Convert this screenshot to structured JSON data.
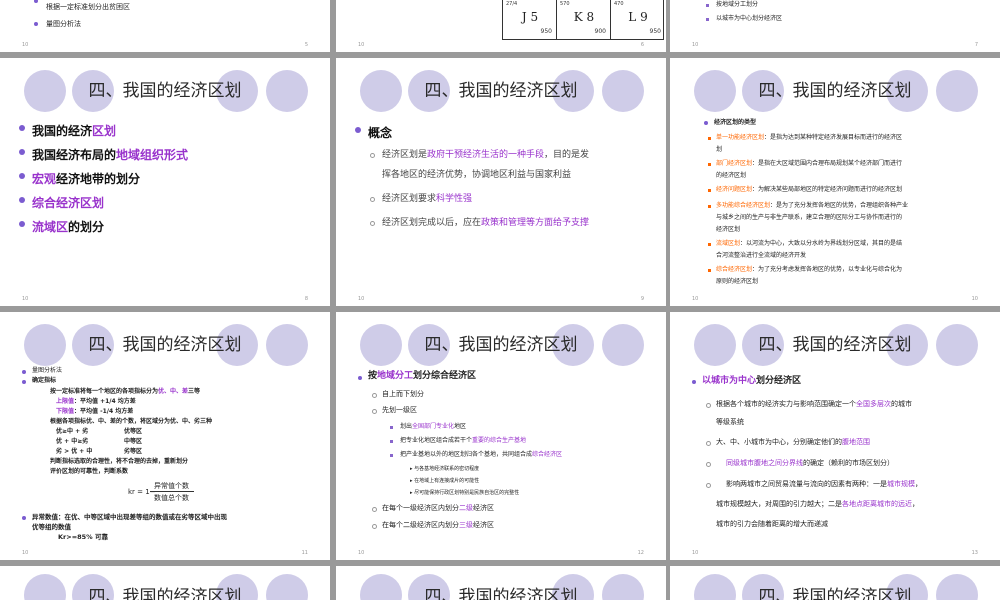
{
  "slides": {
    "s5": {
      "lines": [
        "根据一定标准划分出贫困区",
        "量图分析法"
      ],
      "page_left": "10",
      "page_right": "5"
    },
    "s6": {
      "cells": [
        {
          "code": "J 5",
          "num": "950",
          "top": "27/4"
        },
        {
          "code": "K 8",
          "num": "900",
          "top": "570"
        },
        {
          "code": "L 9",
          "num": "950",
          "top": "470"
        }
      ],
      "page_left": "10",
      "page_right": "6"
    },
    "s7": {
      "lines": [
        "按地域分工划分",
        "以城市为中心划分经济区"
      ],
      "page_left": "10",
      "page_right": "7"
    },
    "s8": {
      "title": "四、我国的经济区划",
      "items": [
        {
          "pre": "我国的经济",
          "hl": "区划",
          "post": ""
        },
        {
          "pre": "我国经济布局的",
          "hl": "地域组织形式",
          "post": ""
        },
        {
          "pre": "",
          "hl": "宏观",
          "post": "经济地带的划分"
        },
        {
          "pre": "",
          "hl": "综合经济区划",
          "post": ""
        },
        {
          "pre": "",
          "hl": "流域区",
          "post": "的划分"
        }
      ],
      "page_left": "10",
      "page_right": "8"
    },
    "s9": {
      "title": "四、我国的经济区划",
      "heading": "概念",
      "p1_pre": "经济区划是",
      "p1_hl": "政府干预经济生活的一种手段",
      "p1_post": "，目的是发",
      "p1_line2": "挥各地区的经济优势，协调地区利益与国家利益",
      "p2_pre": "经济区划要求",
      "p2_hl": "科学性强",
      "p3_pre": "经济区划完成以后，应在",
      "p3_hl": "政策和管理等方面给予支撑",
      "page_left": "10",
      "page_right": "9"
    },
    "s10": {
      "title": "四、我国的经济区划",
      "heading": "经济区划的类型",
      "types": [
        {
          "name": "单一功能经济区划",
          "desc": "：是指为达到某种特定经济发展目标而进行的经济区",
          "cont": "划"
        },
        {
          "name": "部门经济区划",
          "desc": "：是指在大区域范围内合理布局规划某个经济部门而进行",
          "cont": "的经济区划"
        },
        {
          "name": "经济问题区划",
          "desc": "：为解决某些局部地区的特定经济问题而进行的经济区划",
          "cont": ""
        },
        {
          "name": "多功能综合经济区划",
          "desc": "：是为了充分发挥各地区的优势，合理组织各种产业",
          "cont": "与城乡之间的生产与非生产联系，建立合理的区际分工与协作而进行的",
          "cont2": "经济区划"
        },
        {
          "name": "流域区划",
          "desc": "：以河流为中心，大致以分水岭为界线划分区域，其目的是结",
          "cont": "合河流整治进行全流域的经济开发"
        },
        {
          "name": "综合经济区划",
          "desc": "：为了充分考虑发挥各地区的优势，以专业化与综合化为",
          "cont": "原则的经济区划"
        }
      ],
      "page_left": "10",
      "page_right": "10"
    },
    "s11": {
      "title": "四、我国的经济区划",
      "l1": "量图分析法",
      "l2": "确定指标",
      "l3_pre": "按一定标准将每一个地区的各项指标分为",
      "l3_hl": "优、中、差",
      "l3_post": "三等",
      "l4": "上限值：平均值 +1/4 均方差",
      "l5": "下限值：平均值 -1/4 均方差",
      "l6": "根据各项指标优、中、差的个数，将区域分为优、中、劣三种",
      "l7a": "优≥中 + 劣",
      "l7b": "优等区",
      "l8a": "优 + 中≥劣",
      "l8b": "中等区",
      "l9a": "劣 > 优 + 中",
      "l9b": "劣等区",
      "l10": "判断指标选取的合理性，将不合理的去掉，重新划分",
      "l11": "评价区划的可靠性，判断系数",
      "frac_lhs": "kr = 1−",
      "frac_top": "异常值个数",
      "frac_bot": "数值总个数",
      "l12": "异常数值：在优、中等区域中出现差等组的数值或在劣等区域中出现",
      "l13": "优等组的数值",
      "l14": "Kr>=85% 可靠",
      "page_left": "10",
      "page_right": "11"
    },
    "s12": {
      "title": "四、我国的经济区划",
      "h_pre": "按",
      "h_hl": "地域分工",
      "h_post": "划分综合经济区",
      "a1": "自上而下划分",
      "a2": "先划一级区",
      "b1_pre": "划出",
      "b1_hl": "全国部门专业化",
      "b1_post": "地区",
      "b2_pre": "把专业化地区组合成若干个",
      "b2_hl": "重要的综合生产基地",
      "b3_pre": "把产业基地以外的地区划归各个基地，共同组合成",
      "b3_hl": "综合经济区",
      "c1": "与各基地经济联系的密切程度",
      "c2": "在地域上有连接成片的可能性",
      "c3": "尽可能保持行政区划特别是民族自治区的完整性",
      "a3_pre": "在每个一级经济区内划分",
      "a3_hl": "二级",
      "a3_post": "经济区",
      "a4_pre": "在每个二级经济区内划分",
      "a4_hl": "三级",
      "a4_post": "经济区",
      "page_left": "10",
      "page_right": "12"
    },
    "s13": {
      "title": "四、我国的经济区划",
      "h_hl": "以城市为中心",
      "h_post": "划分经济区",
      "p1_pre": "根据各个城市的经济实力与影响范围确定一个",
      "p1_hl": "全国多层次",
      "p1_post": "的城市",
      "p1_line2": "等级系统",
      "p2_pre": "大、中、小城市为中心，分别确定他们的",
      "p2_hl": "腹地范围",
      "p3_hl": "同级城市腹地之间分界线",
      "p3_post": "的确定（赖利的市场区划分）",
      "p4_pre": "影响两城市之间贸易流量与流向的因素有两种：一是",
      "p4_hl": "城市规模",
      "p4_post": "，",
      "p4_line2_pre": "城市规模越大，对周围的引力越大；二是",
      "p4_line2_hl": "各地点距离城市的远近",
      "p4_line2_post": "，",
      "p4_line3": "城市的引力会随着距离的增大而递减",
      "page_left": "10",
      "page_right": "13"
    },
    "row3": {
      "title": "四、我国的经济区划"
    }
  },
  "colors": {
    "highlight": "#9933cc",
    "orange": "#ff6600",
    "circle": "#cfcce8",
    "background": "#9a9a9a"
  }
}
